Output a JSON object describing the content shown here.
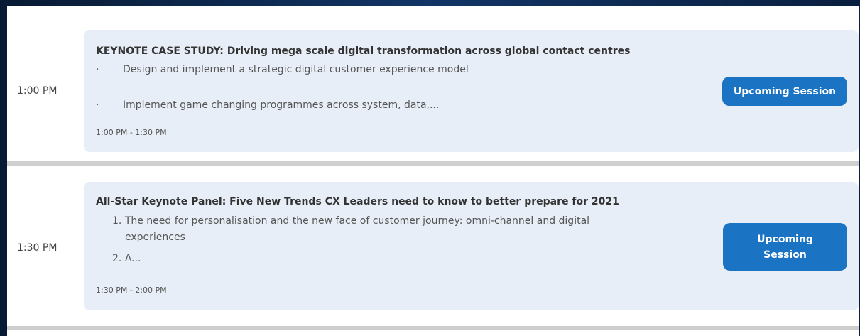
{
  "sessions": [
    {
      "time": "1:00 PM",
      "title": "KEYNOTE CASE STUDY: Driving mega scale digital transformation across global contact centres",
      "items": [
        {
          "marker": "·",
          "text": "Design and implement a strategic digital customer experience model"
        },
        {
          "marker": "·",
          "text": "Implement game changing programmes across system, data,..."
        }
      ],
      "range": "1:00 PM - 1:30 PM",
      "button": "Upcoming Session"
    },
    {
      "time": "1:30 PM",
      "title": "All-Star Keynote Panel: Five New Trends CX Leaders need to know to better prepare for 2021",
      "items": [
        {
          "marker": "1.",
          "text": "The need for personalisation and the new face of customer journey: omni-channel and digital",
          "cont": "experiences"
        },
        {
          "marker": "2.",
          "text": "A..."
        }
      ],
      "range": "1:30 PM - 2:00 PM",
      "button_lines": [
        "Upcoming",
        "Session"
      ]
    }
  ]
}
